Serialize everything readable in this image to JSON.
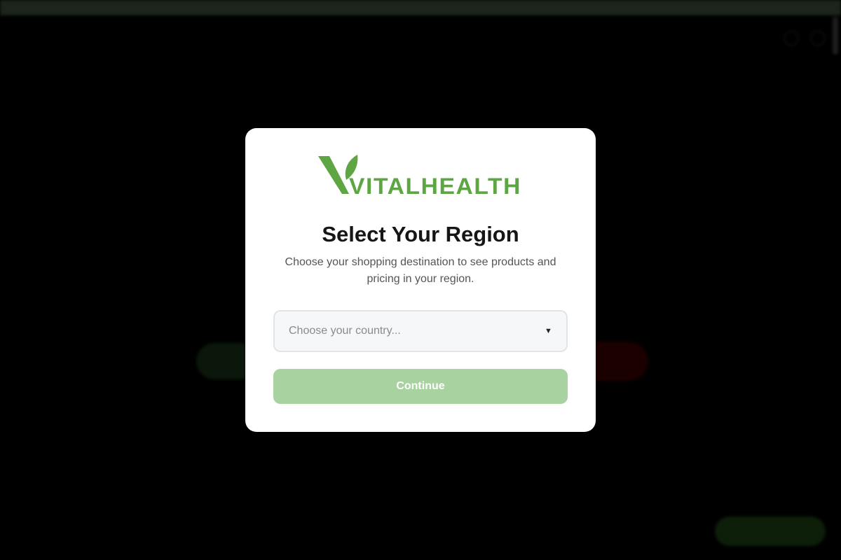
{
  "modal": {
    "brand": "VITALHEALTH",
    "title": "Select Your Region",
    "description": "Choose your shopping destination to see products and pricing in your region.",
    "country_select": {
      "placeholder": "Choose your country..."
    },
    "continue_label": "Continue"
  },
  "colors": {
    "brand_green": "#5da643",
    "continue_disabled": "#a8d2a0",
    "modal_background": "#ffffff"
  },
  "icons": {
    "logo": "leaf-v-icon",
    "dropdown": "chevron-down-icon"
  }
}
